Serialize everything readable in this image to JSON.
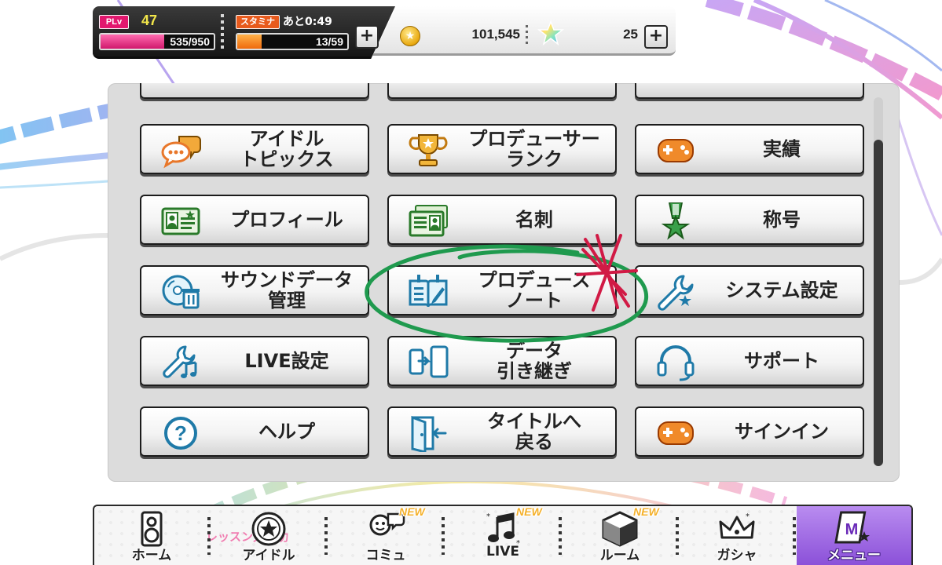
{
  "status": {
    "plv_badge": "PLv",
    "level": "47",
    "exp_text": "535/950",
    "exp_fraction": 0.563,
    "stamina_badge": "スタミナ",
    "stamina_recover": "あと0:49",
    "stamina_text": "13/59",
    "stamina_fraction": 0.22,
    "money": "101,545",
    "jewels": "25",
    "plus_label": "+"
  },
  "menu": {
    "items": [
      {
        "label": "アイドル\nトピックス",
        "icon": "chat-bubbles-icon"
      },
      {
        "label": "プロデューサー\nランク",
        "icon": "trophy-icon"
      },
      {
        "label": "実績",
        "icon": "gamepad-icon"
      },
      {
        "label": "プロフィール",
        "icon": "profile-card-icon"
      },
      {
        "label": "名刺",
        "icon": "business-cards-icon"
      },
      {
        "label": "称号",
        "icon": "medal-icon"
      },
      {
        "label": "サウンドデータ\n管理",
        "icon": "cd-trash-icon"
      },
      {
        "label": "プロデュース\nノート",
        "icon": "notebook-icon"
      },
      {
        "label": "システム設定",
        "icon": "wrench-star-icon"
      },
      {
        "label": "LIVE設定",
        "icon": "wrench-music-icon"
      },
      {
        "label": "データ\n引き継ぎ",
        "icon": "phone-transfer-icon"
      },
      {
        "label": "サポート",
        "icon": "headset-icon"
      },
      {
        "label": "ヘルプ",
        "icon": "question-icon"
      },
      {
        "label": "タイトルへ\n戻る",
        "icon": "exit-door-icon"
      },
      {
        "label": "サインイン",
        "icon": "gamepad-icon"
      }
    ]
  },
  "nav": {
    "tabs": [
      {
        "label": "ホーム",
        "icon": "speaker-icon",
        "new": ""
      },
      {
        "label": "アイドル",
        "icon": "star-medal-icon",
        "new": ""
      },
      {
        "label": "コミュ",
        "icon": "talk-icon",
        "new": "NEW"
      },
      {
        "label": "LIVE",
        "icon": "music-note-icon",
        "new": "NEW"
      },
      {
        "label": "ルーム",
        "icon": "room-cube-icon",
        "new": "NEW"
      },
      {
        "label": "ガシャ",
        "icon": "crown-icon",
        "new": ""
      },
      {
        "label": "メニュー",
        "icon": "menu-book-icon",
        "new": ""
      }
    ],
    "lesson_text": "レッスン大成功"
  },
  "colors": {
    "accent_pink": "#e2176e",
    "stamina_orange": "#ef6a0c",
    "menu_active_purple": "#8a4fd8",
    "annotation_green": "#1f9a4e",
    "annotation_red": "#d11a45"
  }
}
